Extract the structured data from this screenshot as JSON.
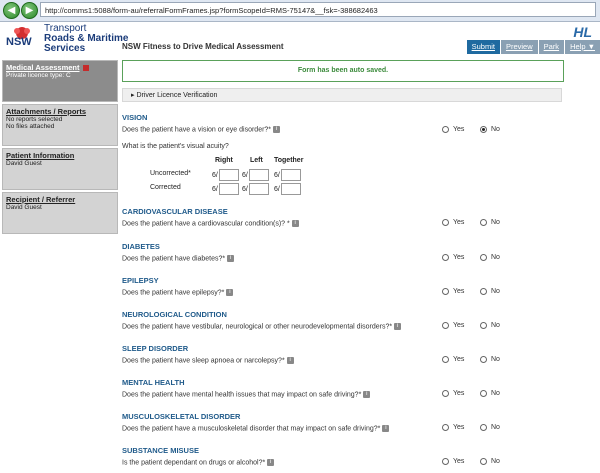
{
  "browser": {
    "url": "http://comms1:5088/form-au/referralFormFrames.jsp?formScopeId=RMS-75147&__fsk=-388682463"
  },
  "header": {
    "logo_text": "NSW",
    "brand_line1": "Transport",
    "brand_line2": "Roads & Maritime",
    "brand_line3": "Services",
    "corner_logo": "HL",
    "app_title": "NSW Fitness to Drive Medical Assessment",
    "buttons": {
      "submit": "Submit",
      "preview": "Preview",
      "park": "Park",
      "help": "Help ▼"
    }
  },
  "sidebar": {
    "items": [
      {
        "title": "Medical Assessment",
        "sub1": "Private licence type: C",
        "sub2": ""
      },
      {
        "title": "Attachments / Reports",
        "sub1": "No reports selected",
        "sub2": "No files attached"
      },
      {
        "title": "Patient Information",
        "sub1": "David Guest",
        "sub2": ""
      },
      {
        "title": "Recipient / Referrer",
        "sub1": "David Guest",
        "sub2": ""
      }
    ]
  },
  "main": {
    "saved_message": "Form has been auto saved.",
    "dlv_section": "Driver Licence Verification",
    "yes_label": "Yes",
    "no_label": "No",
    "vision": {
      "heading": "VISION",
      "question": "Does the patient have a vision or eye disorder?*",
      "answer": "No",
      "acuity_question": "What is the patient's visual acuity?",
      "col_right": "Right",
      "col_left": "Left",
      "col_together": "Together",
      "row_uncorrected": "Uncorrected*",
      "row_corrected": "Corrected",
      "prefix": "6/"
    },
    "sections": [
      {
        "heading": "CARDIOVASCULAR DISEASE",
        "question": "Does the patient have a cardiovascular condition(s)? *"
      },
      {
        "heading": "DIABETES",
        "question": "Does the patient have diabetes?*"
      },
      {
        "heading": "EPILEPSY",
        "question": "Does the patient have epilepsy?*"
      },
      {
        "heading": "NEUROLOGICAL CONDITION",
        "question": "Does the patient have vestibular, neurological or other neurodevelopmental disorders?*"
      },
      {
        "heading": "SLEEP DISORDER",
        "question": "Does the patient have sleep apnoea or narcolepsy?*"
      },
      {
        "heading": "MENTAL HEALTH",
        "question": "Does the patient have mental health issues that may impact on safe driving?*"
      },
      {
        "heading": "MUSCULOSKELETAL DISORDER",
        "question": "Does the patient have a musculoskeletal disorder that may impact on safe driving?*"
      },
      {
        "heading": "SUBSTANCE MISUSE",
        "question": "Is the patient dependant on drugs or alcohol?*"
      }
    ]
  }
}
